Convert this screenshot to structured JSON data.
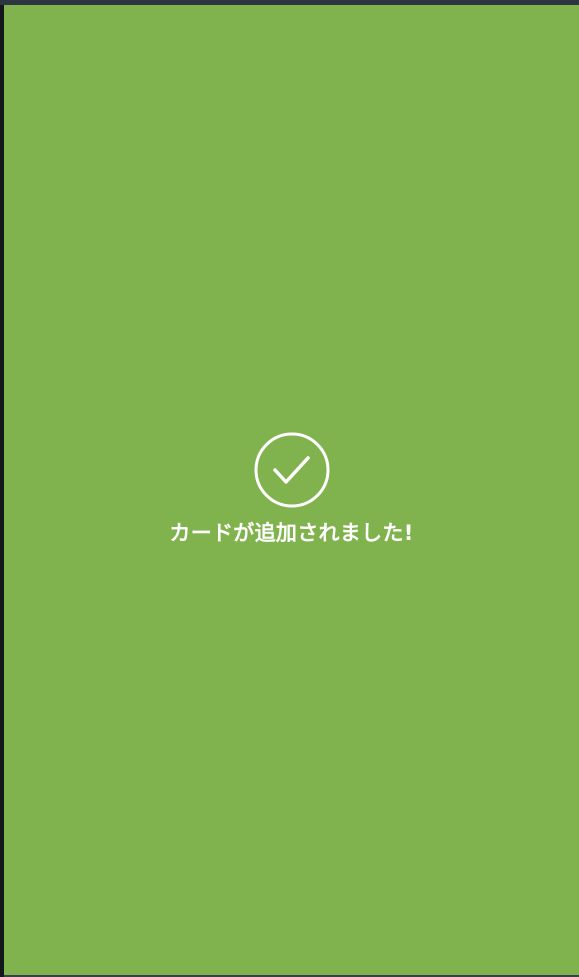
{
  "screen": {
    "background_color": "#80b34d",
    "text_color": "#ffffff"
  },
  "success": {
    "icon": "check-circle-icon",
    "message": "カードが追加されました!"
  }
}
